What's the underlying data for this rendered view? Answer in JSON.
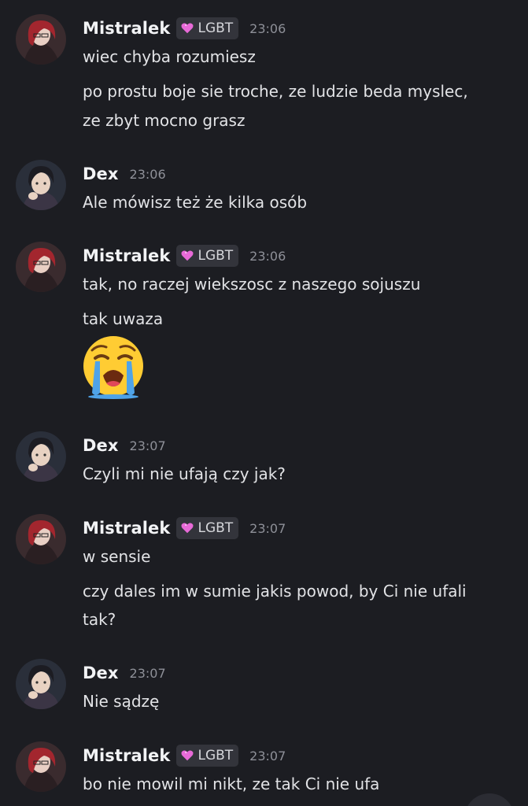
{
  "messages": [
    {
      "author": "Mistralek",
      "role": "LGBT",
      "time": "23:06",
      "lines": [
        "wiec chyba rozumiesz",
        "po prostu boje sie troche, ze ludzie beda myslec,",
        "ze zbyt mocno grasz"
      ]
    },
    {
      "author": "Dex",
      "time": "23:06",
      "lines": [
        "Ale mówisz też że kilka osób"
      ]
    },
    {
      "author": "Mistralek",
      "role": "LGBT",
      "time": "23:06",
      "lines": [
        "tak, no raczej wiekszosc z naszego sojuszu",
        "tak uwaza"
      ],
      "emoji": "loudly-crying-face-emoji"
    },
    {
      "author": "Dex",
      "time": "23:07",
      "lines": [
        "Czyli mi nie ufają czy jak?"
      ]
    },
    {
      "author": "Mistralek",
      "role": "LGBT",
      "time": "23:07",
      "lines": [
        "w sensie",
        "czy dales im w sumie jakis powod, by Ci nie ufali",
        "tak?"
      ]
    },
    {
      "author": "Dex",
      "time": "23:07",
      "lines": [
        "Nie sądzę"
      ]
    },
    {
      "author": "Mistralek",
      "role": "LGBT",
      "time": "23:07",
      "lines": [
        "bo nie mowil mi nikt, ze tak Ci nie ufa"
      ]
    }
  ],
  "colors": {
    "background": "#1c1d22",
    "role_heart": "#e86ad8",
    "role_tag_bg": "#33343b"
  }
}
